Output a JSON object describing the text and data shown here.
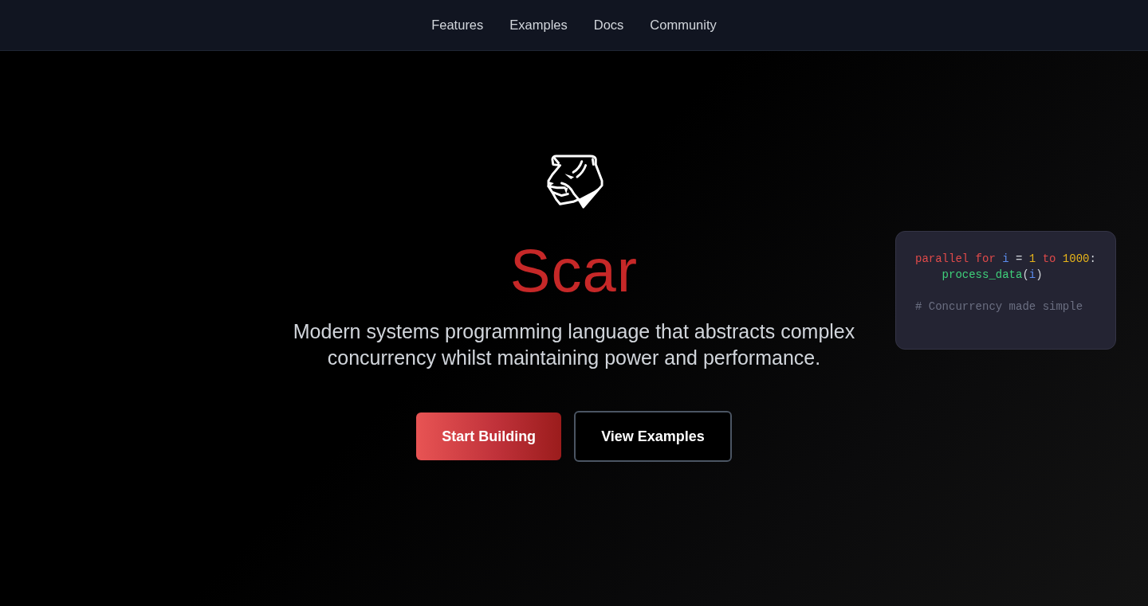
{
  "nav": {
    "links": [
      {
        "label": "Features"
      },
      {
        "label": "Examples"
      },
      {
        "label": "Docs"
      },
      {
        "label": "Community"
      }
    ]
  },
  "hero": {
    "title": "Scar",
    "subtitle": "Modern systems programming language that abstracts complex concurrency whilst maintaining power and performance.",
    "buttons": [
      {
        "label": "Start Building",
        "kind": "primary"
      },
      {
        "label": "View Examples",
        "kind": "secondary"
      }
    ]
  },
  "code_card": {
    "lines": [
      {
        "kind": "code",
        "tokens": [
          {
            "text": "parallel for ",
            "kind": "keyword"
          },
          {
            "text": "i",
            "kind": "variable"
          },
          {
            "text": " = ",
            "kind": "plain"
          },
          {
            "text": "1",
            "kind": "number"
          },
          {
            "text": " to ",
            "kind": "keyword"
          },
          {
            "text": "1000",
            "kind": "number"
          },
          {
            "text": ":",
            "kind": "plain"
          }
        ]
      },
      {
        "kind": "code",
        "tokens": [
          {
            "text": "    process_data",
            "kind": "function"
          },
          {
            "text": "(",
            "kind": "plain"
          },
          {
            "text": "i",
            "kind": "variable"
          },
          {
            "text": ")",
            "kind": "plain"
          }
        ]
      },
      {
        "kind": "blank"
      },
      {
        "kind": "comment",
        "tokens": [
          {
            "text": "# Concurrency made simple",
            "kind": "comment"
          }
        ]
      }
    ]
  }
}
